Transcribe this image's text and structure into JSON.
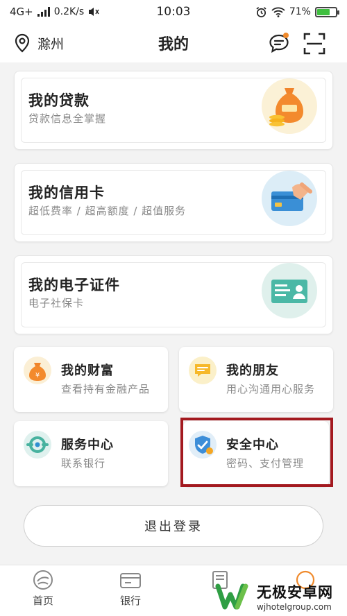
{
  "status_bar": {
    "network": "4G+",
    "speed": "0.2K/s",
    "time": "10:03",
    "battery": "71%",
    "battery_level": 0.71
  },
  "nav": {
    "location": "滁州",
    "title": "我的"
  },
  "cards": [
    {
      "title": "我的贷款",
      "subtitle": "贷款信息全掌握",
      "icon": "money-bag-icon"
    },
    {
      "title": "我的信用卡",
      "subtitle": "超低费率 / 超高额度 / 超值服务",
      "icon": "credit-card-icon"
    },
    {
      "title": "我的电子证件",
      "subtitle": "电子社保卡",
      "icon": "id-card-icon"
    }
  ],
  "grid": [
    {
      "title": "我的财富",
      "subtitle": "查看持有金融产品",
      "icon": "wealth-icon"
    },
    {
      "title": "我的朋友",
      "subtitle": "用心沟通用心服务",
      "icon": "friends-icon"
    },
    {
      "title": "服务中心",
      "subtitle": "联系银行",
      "icon": "service-icon"
    },
    {
      "title": "安全中心",
      "subtitle": "密码、支付管理",
      "icon": "security-icon"
    }
  ],
  "logout_label": "退出登录",
  "tabs": [
    {
      "label": "首页"
    },
    {
      "label": "银行"
    }
  ],
  "watermark": {
    "name": "无极安卓网",
    "url": "wjhotelgroup.com"
  },
  "colors": {
    "accent": "#f5a623",
    "highlight": "#a3191f",
    "notification": "#f08a2c"
  }
}
